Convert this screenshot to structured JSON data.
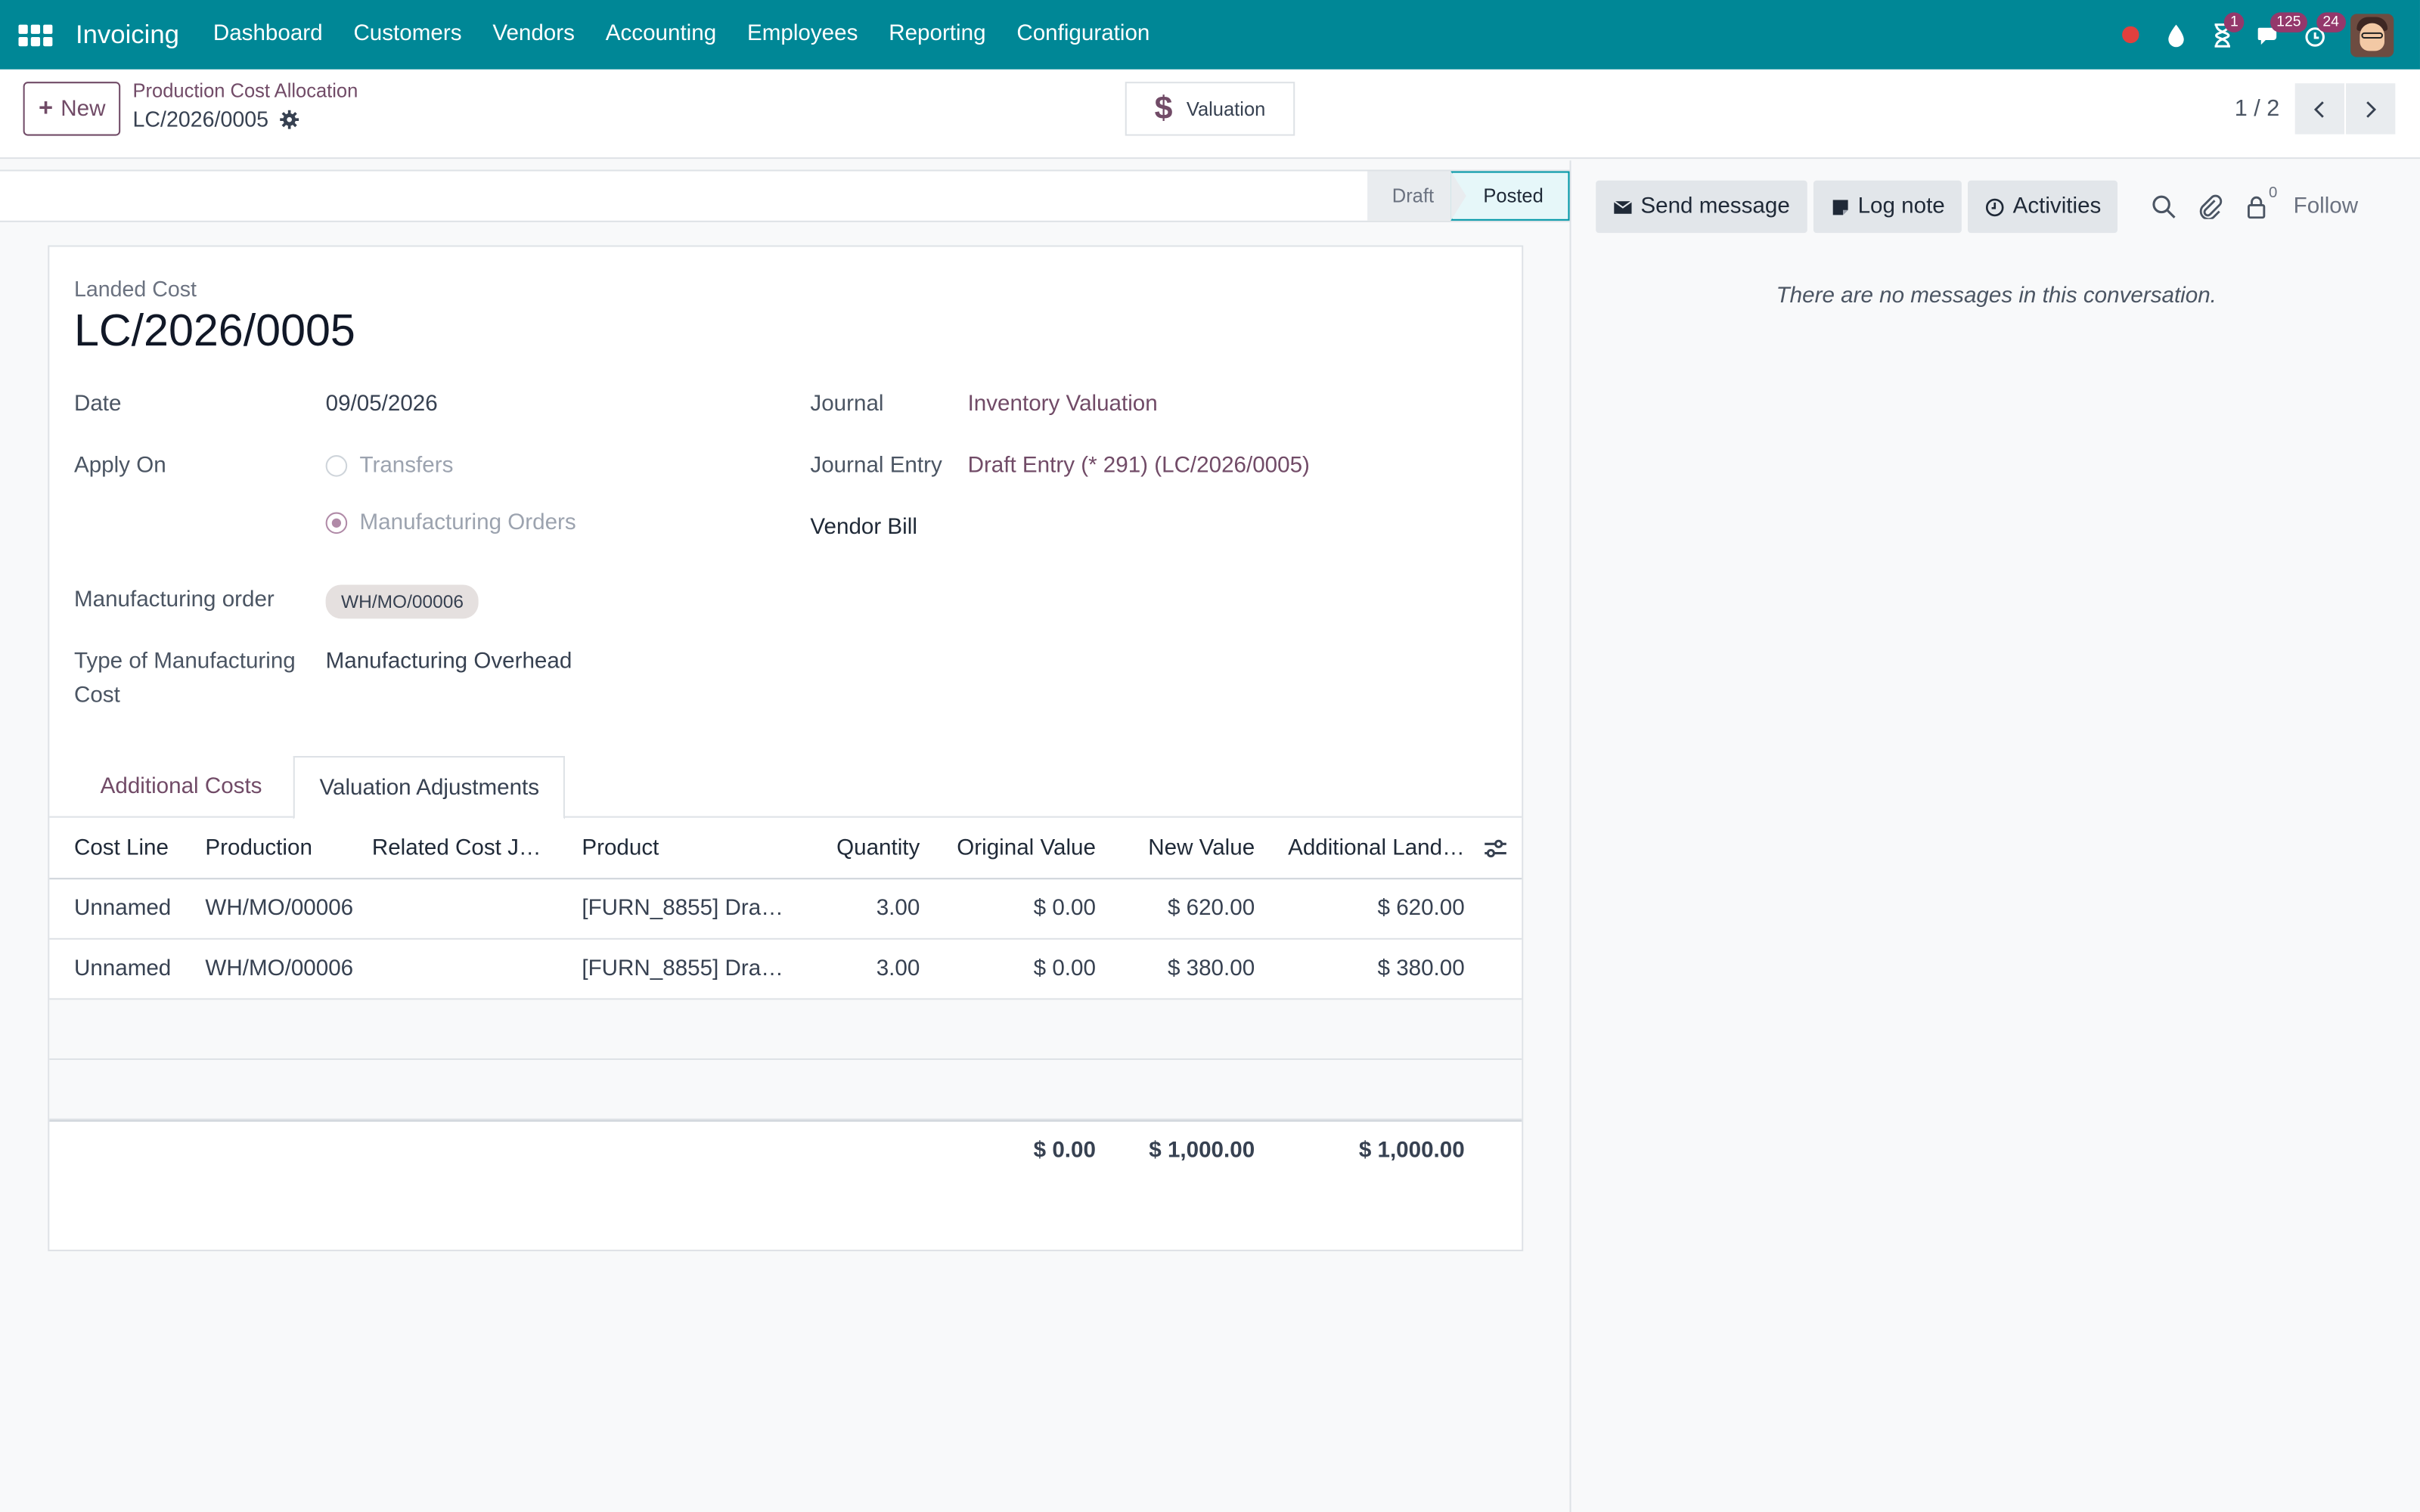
{
  "navbar": {
    "brand": "Invoicing",
    "menu": [
      "Dashboard",
      "Customers",
      "Vendors",
      "Accounting",
      "Employees",
      "Reporting",
      "Configuration"
    ],
    "badges": {
      "activities": "1",
      "messages": "125",
      "timer": "24"
    }
  },
  "control": {
    "new_label": "New",
    "breadcrumb_parent": "Production Cost Allocation",
    "breadcrumb_current": "LC/2026/0005",
    "smart_button": "Valuation",
    "pager": "1 / 2"
  },
  "status": {
    "steps": [
      "Draft",
      "Posted"
    ],
    "current": "Posted"
  },
  "form": {
    "label": "Landed Cost",
    "title": "LC/2026/0005",
    "date_label": "Date",
    "date_value": "09/05/2026",
    "apply_on_label": "Apply On",
    "apply_on_options": [
      "Transfers",
      "Manufacturing Orders"
    ],
    "apply_on_selected": "Manufacturing Orders",
    "mo_label": "Manufacturing order",
    "mo_tag": "WH/MO/00006",
    "type_label_1": "Type of Manufacturing",
    "type_label_2": "Cost",
    "type_value": "Manufacturing Overhead",
    "journal_label": "Journal",
    "journal_value": "Inventory Valuation",
    "journal_entry_label": "Journal Entry",
    "journal_entry_value": "Draft Entry (* 291) (LC/2026/0005)",
    "vendor_bill_label": "Vendor Bill"
  },
  "tabs": [
    "Additional Costs",
    "Valuation Adjustments"
  ],
  "active_tab": "Valuation Adjustments",
  "table": {
    "headers": [
      "Cost Line",
      "Production",
      "Related Cost J…",
      "Product",
      "Quantity",
      "Original Value",
      "New Value",
      "Additional Land…"
    ],
    "rows": [
      [
        "Unnamed",
        "WH/MO/00006",
        "",
        "[FURN_8855] Dra…",
        "3.00",
        "$ 0.00",
        "$ 620.00",
        "$ 620.00"
      ],
      [
        "Unnamed",
        "WH/MO/00006",
        "",
        "[FURN_8855] Dra…",
        "3.00",
        "$ 0.00",
        "$ 380.00",
        "$ 380.00"
      ]
    ],
    "totals": {
      "original": "$ 0.00",
      "new": "$ 1,000.00",
      "additional": "$ 1,000.00"
    }
  },
  "chatter": {
    "send_message": "Send message",
    "log_note": "Log note",
    "activities": "Activities",
    "follower_count": "0",
    "follow": "Follow",
    "empty": "There are no messages in this conversation."
  },
  "colors": {
    "navbar": "#008796",
    "accent": "#714b67",
    "posted_border": "#0097a7"
  }
}
